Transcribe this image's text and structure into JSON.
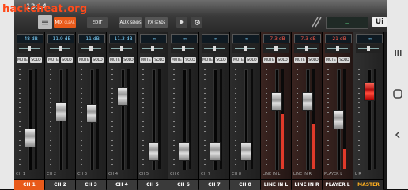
{
  "watermark": "hackcheat.org",
  "status": {
    "time": "13:14"
  },
  "toolbar": {
    "mix_label": "MIX",
    "mix_sub": "CLEAR",
    "edit_label": "EDIT",
    "aux_label": "AUX",
    "aux_sub": "SENDS",
    "fx_label": "FX",
    "fx_sub": "SENDS",
    "lcd_value": "—",
    "logo": "Ui"
  },
  "channels": [
    {
      "label": "CH 1",
      "small": "CH 1",
      "gain": "-48 dB",
      "mute": "MUTE",
      "solo": "SOLO",
      "fader": 0.28,
      "meter": 0,
      "type": "ch",
      "selected": true
    },
    {
      "label": "CH 2",
      "small": "CH 2",
      "gain": "-11.9 dB",
      "mute": "MUTE",
      "solo": "SOLO",
      "fader": 0.6,
      "meter": 0,
      "type": "ch"
    },
    {
      "label": "CH 3",
      "small": "CH 3",
      "gain": "-11 dB",
      "mute": "MUTE",
      "solo": "SOLO",
      "fader": 0.58,
      "meter": 0,
      "type": "ch"
    },
    {
      "label": "CH 4",
      "small": "CH 4",
      "gain": "-11.3 dB",
      "mute": "MUTE",
      "solo": "SOLO",
      "fader": 0.79,
      "meter": 0,
      "type": "ch"
    },
    {
      "label": "CH 5",
      "small": "CH 5",
      "gain": "-∞",
      "mute": "MUTE",
      "solo": "SOLO",
      "fader": 0.12,
      "meter": 0,
      "type": "ch"
    },
    {
      "label": "CH 6",
      "small": "CH 6",
      "gain": "-∞",
      "mute": "MUTE",
      "solo": "SOLO",
      "fader": 0.12,
      "meter": 0,
      "type": "ch"
    },
    {
      "label": "CH 7",
      "small": "CH 7",
      "gain": "-∞",
      "mute": "MUTE",
      "solo": "SOLO",
      "fader": 0.12,
      "meter": 0,
      "type": "ch"
    },
    {
      "label": "CH 8",
      "small": "CH 8",
      "gain": "-∞",
      "mute": "MUTE",
      "solo": "SOLO",
      "fader": 0.12,
      "meter": 0,
      "type": "ch"
    },
    {
      "label": "LINE IN L",
      "small": "LINE IN L",
      "gain": "-7.3 dB",
      "mute": "MUTE",
      "solo": "SOLO",
      "fader": 0.72,
      "meter": 0.55,
      "type": "line"
    },
    {
      "label": "LINE IN R",
      "small": "LINE IN R",
      "gain": "-7.3 dB",
      "mute": "MUTE",
      "solo": "SOLO",
      "fader": 0.72,
      "meter": 0.45,
      "type": "line"
    },
    {
      "label": "PLAYER L",
      "small": "PLAYER L",
      "gain": "-21 dB",
      "mute": "MUTE",
      "solo": "SOLO",
      "fader": 0.5,
      "meter": 0.2,
      "type": "line"
    },
    {
      "label": "MASTER",
      "small": "L R",
      "gain": "-∞",
      "mute": "",
      "solo": "",
      "fader": 0.85,
      "meter": 0,
      "type": "master"
    }
  ]
}
